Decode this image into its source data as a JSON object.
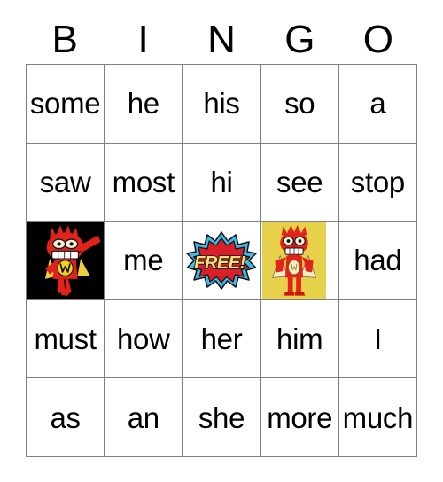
{
  "card": {
    "title": "BINGO",
    "header": [
      "B",
      "I",
      "N",
      "G",
      "O"
    ],
    "columns": 5,
    "rows": 5,
    "grid_line_color": "#808080",
    "background_color": "#ffffff",
    "text_color": "#000000",
    "cells": [
      [
        {
          "type": "text",
          "value": "some"
        },
        {
          "type": "text",
          "value": "he"
        },
        {
          "type": "text",
          "value": "his"
        },
        {
          "type": "text",
          "value": "so"
        },
        {
          "type": "text",
          "value": "a"
        }
      ],
      [
        {
          "type": "text",
          "value": "saw"
        },
        {
          "type": "text",
          "value": "most"
        },
        {
          "type": "text",
          "value": "hi"
        },
        {
          "type": "text",
          "value": "see"
        },
        {
          "type": "text",
          "value": "stop"
        }
      ],
      [
        {
          "type": "image",
          "value": "",
          "image_name": "red-superhero-black-background",
          "background": "#000000"
        },
        {
          "type": "text",
          "value": "me"
        },
        {
          "type": "image",
          "value": "FREE!",
          "image_name": "free-space-starburst",
          "background": "#ffffff"
        },
        {
          "type": "image",
          "value": "",
          "image_name": "red-superhero-yellow-background",
          "background": "#e8d14a"
        },
        {
          "type": "text",
          "value": "had"
        }
      ],
      [
        {
          "type": "text",
          "value": "must"
        },
        {
          "type": "text",
          "value": "how"
        },
        {
          "type": "text",
          "value": "her"
        },
        {
          "type": "text",
          "value": "him"
        },
        {
          "type": "text",
          "value": "I"
        }
      ],
      [
        {
          "type": "text",
          "value": "as"
        },
        {
          "type": "text",
          "value": "an"
        },
        {
          "type": "text",
          "value": "she"
        },
        {
          "type": "text",
          "value": "more"
        },
        {
          "type": "text",
          "value": "much"
        }
      ]
    ],
    "free_space": {
      "label": "FREE!",
      "text_color": "#f2e07a",
      "inner_burst_color": "#d72027",
      "outer_burst_color": "#3fb9e5",
      "outline_color": "#000000"
    },
    "art_colors": {
      "character_body": "#e2231a",
      "character_cape": "#f0d040",
      "emblem": "#f4d11a",
      "black_background": "#000000",
      "yellow_background": "#e8d14a"
    }
  }
}
